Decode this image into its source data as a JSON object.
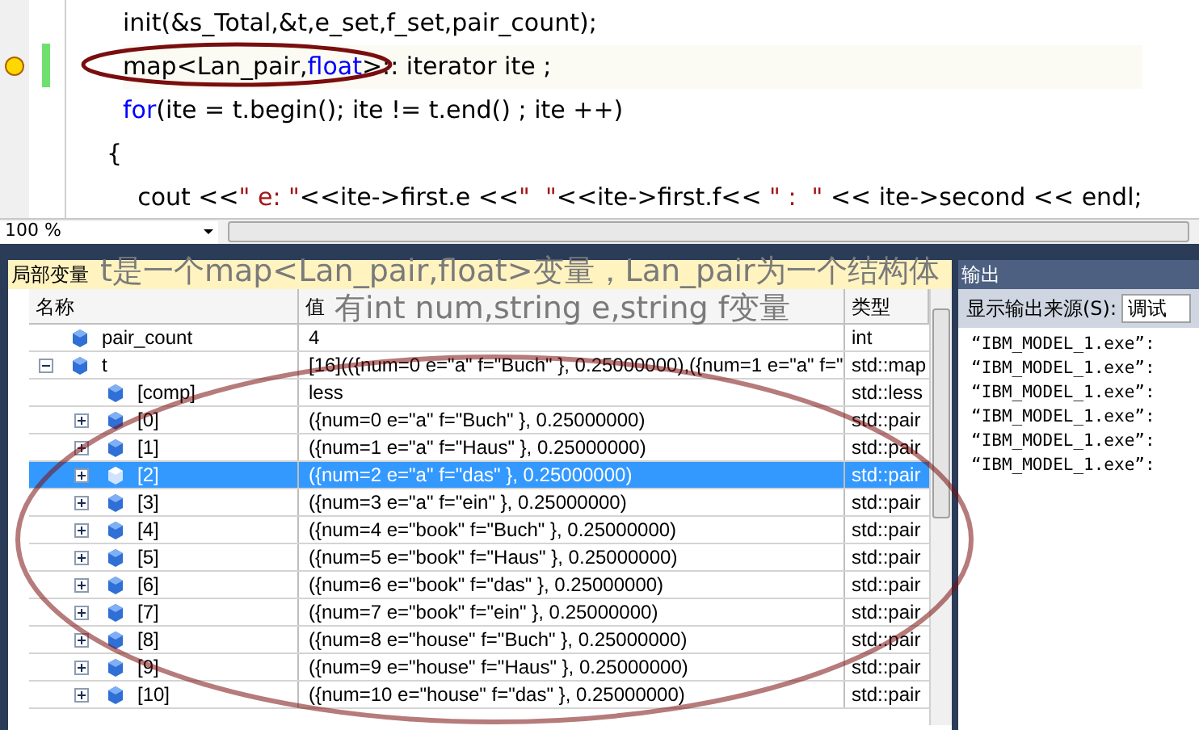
{
  "editor": {
    "lines": [
      {
        "current": false,
        "tokens": [
          {
            "kind": "plain",
            "text": "init(&s_Total,&t,e_set,f_set,pair_count);"
          }
        ]
      },
      {
        "current": true,
        "tokens": [
          {
            "kind": "plain",
            "text": "map<Lan_pair,"
          },
          {
            "kind": "keyword",
            "text": "float"
          },
          {
            "kind": "plain",
            "text": ">:: iterator ite ;"
          }
        ]
      },
      {
        "current": false,
        "tokens": [
          {
            "kind": "keyword",
            "text": "for"
          },
          {
            "kind": "plain",
            "text": "(ite = t.begin(); ite != t.end() ; ite ++)"
          }
        ]
      },
      {
        "current": false,
        "tokens": [
          {
            "kind": "plain",
            "text": "{"
          }
        ]
      },
      {
        "current": false,
        "tokens": [
          {
            "kind": "plain",
            "text": "    cout <<"
          },
          {
            "kind": "string",
            "text": "\" e: \""
          },
          {
            "kind": "plain",
            "text": "<<ite->first.e <<"
          },
          {
            "kind": "string",
            "text": "\"  \""
          },
          {
            "kind": "plain",
            "text": "<<ite->first.f<< "
          },
          {
            "kind": "string",
            "text": "\" :  \""
          },
          {
            "kind": "plain",
            "text": " << ite->second << endl;"
          }
        ]
      }
    ],
    "zoom": "100 %"
  },
  "locals": {
    "title": "局部变量",
    "columns": [
      "名称",
      "值",
      "类型"
    ],
    "rows": [
      {
        "name": "pair_count",
        "value": "4",
        "type": "int",
        "selected": false
      },
      {
        "name": "t",
        "value": "[16](({num=0 e=\"a\" f=\"Buch\" }, 0.25000000),({num=1 e=\"a\" f=\"",
        "type": "std::map",
        "selected": false,
        "expanded": true,
        "children": [
          {
            "name": "[comp]",
            "value": "less",
            "type": "std::less",
            "selected": false
          },
          {
            "name": "[0]",
            "value": "({num=0 e=\"a\" f=\"Buch\" }, 0.25000000)",
            "type": "std::pair",
            "selected": false,
            "expanded": false
          },
          {
            "name": "[1]",
            "value": "({num=1 e=\"a\" f=\"Haus\" }, 0.25000000)",
            "type": "std::pair",
            "selected": false,
            "expanded": false
          },
          {
            "name": "[2]",
            "value": "({num=2 e=\"a\" f=\"das\" }, 0.25000000)",
            "type": "std::pair",
            "selected": true,
            "expanded": false
          },
          {
            "name": "[3]",
            "value": "({num=3 e=\"a\" f=\"ein\" }, 0.25000000)",
            "type": "std::pair",
            "selected": false,
            "expanded": false
          },
          {
            "name": "[4]",
            "value": "({num=4 e=\"book\" f=\"Buch\" }, 0.25000000)",
            "type": "std::pair",
            "selected": false,
            "expanded": false
          },
          {
            "name": "[5]",
            "value": "({num=5 e=\"book\" f=\"Haus\" }, 0.25000000)",
            "type": "std::pair",
            "selected": false,
            "expanded": false
          },
          {
            "name": "[6]",
            "value": "({num=6 e=\"book\" f=\"das\" }, 0.25000000)",
            "type": "std::pair",
            "selected": false,
            "expanded": false
          },
          {
            "name": "[7]",
            "value": "({num=7 e=\"book\" f=\"ein\" }, 0.25000000)",
            "type": "std::pair",
            "selected": false,
            "expanded": false
          },
          {
            "name": "[8]",
            "value": "({num=8 e=\"house\" f=\"Buch\" }, 0.25000000)",
            "type": "std::pair",
            "selected": false,
            "expanded": false
          },
          {
            "name": "[9]",
            "value": "({num=9 e=\"house\" f=\"Haus\" }, 0.25000000)",
            "type": "std::pair",
            "selected": false,
            "expanded": false
          },
          {
            "name": "[10]",
            "value": "({num=10 e=\"house\" f=\"das\" }, 0.25000000)",
            "type": "std::pair",
            "selected": false,
            "expanded": false
          }
        ]
      }
    ]
  },
  "output": {
    "title": "输出",
    "source_label": "显示输出来源(S):",
    "source": "调试",
    "lines": [
      "“IBM_MODEL_1.exe”:",
      "“IBM_MODEL_1.exe”:",
      "“IBM_MODEL_1.exe”:",
      "“IBM_MODEL_1.exe”:",
      "“IBM_MODEL_1.exe”:",
      "“IBM_MODEL_1.exe”:"
    ]
  },
  "annotation": {
    "lines": [
      "t是一个map<Lan_pair,float>变量，Lan_pair为一个结构体",
      "有int num,string e,string f变量"
    ]
  }
}
